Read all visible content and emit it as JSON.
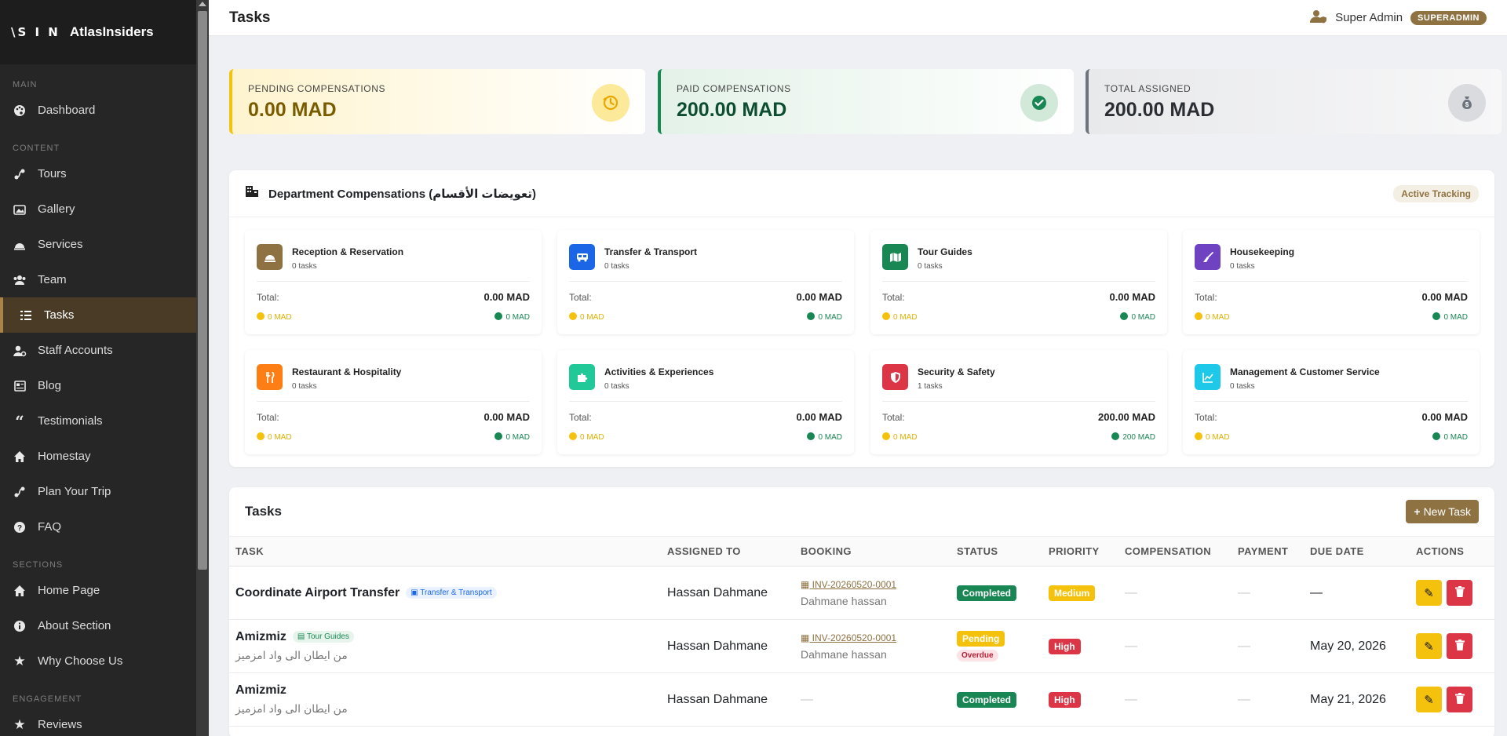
{
  "brand": {
    "logo": "\\S I N",
    "name": "AtlasInsiders"
  },
  "sidebar": {
    "sections": [
      {
        "label": "MAIN",
        "items": [
          {
            "label": "Dashboard",
            "icon": "palette-icon"
          }
        ]
      },
      {
        "label": "CONTENT",
        "items": [
          {
            "label": "Tours",
            "icon": "route-icon"
          },
          {
            "label": "Gallery",
            "icon": "images-icon"
          },
          {
            "label": "Services",
            "icon": "concierge-bell-icon"
          },
          {
            "label": "Team",
            "icon": "users-icon"
          },
          {
            "label": "Tasks",
            "icon": "tasks-icon",
            "active": true
          },
          {
            "label": "Staff Accounts",
            "icon": "user-cog-icon"
          },
          {
            "label": "Blog",
            "icon": "newspaper-icon"
          },
          {
            "label": "Testimonials",
            "icon": "quote-icon"
          },
          {
            "label": "Homestay",
            "icon": "home-icon"
          },
          {
            "label": "Plan Your Trip",
            "icon": "route-icon"
          },
          {
            "label": "FAQ",
            "icon": "question-circle-icon"
          }
        ]
      },
      {
        "label": "SECTIONS",
        "items": [
          {
            "label": "Home Page",
            "icon": "home-icon"
          },
          {
            "label": "About Section",
            "icon": "info-circle-icon"
          },
          {
            "label": "Why Choose Us",
            "icon": "star-icon"
          }
        ]
      },
      {
        "label": "ENGAGEMENT",
        "items": [
          {
            "label": "Reviews",
            "icon": "star-icon"
          }
        ]
      }
    ]
  },
  "header": {
    "title": "Tasks",
    "user_name": "Super Admin",
    "role": "SUPERADMIN"
  },
  "summary": [
    {
      "label": "PENDING COMPENSATIONS",
      "value": "0.00 MAD",
      "icon": "history-icon",
      "color": "#f4c20d"
    },
    {
      "label": "PAID COMPENSATIONS",
      "value": "200.00 MAD",
      "icon": "check-circle-icon",
      "color": "#198754"
    },
    {
      "label": "TOTAL ASSIGNED",
      "value": "200.00 MAD",
      "icon": "money-bag-icon",
      "color": "#6c757d"
    }
  ],
  "departments": {
    "title": "Department Compensations (تعويضات الأقسام)",
    "badge": "Active Tracking",
    "total_label": "Total:",
    "items": [
      {
        "name": "Reception & Reservation",
        "tasks": "0 tasks",
        "total": "0.00 MAD",
        "pending": "0 MAD",
        "paid": "0 MAD",
        "color": "#8e7242",
        "icon": "bell-icon"
      },
      {
        "name": "Transfer & Transport",
        "tasks": "0 tasks",
        "total": "0.00 MAD",
        "pending": "0 MAD",
        "paid": "0 MAD",
        "color": "#1a66e6",
        "icon": "bus-icon"
      },
      {
        "name": "Tour Guides",
        "tasks": "0 tasks",
        "total": "0.00 MAD",
        "pending": "0 MAD",
        "paid": "0 MAD",
        "color": "#198754",
        "icon": "map-icon"
      },
      {
        "name": "Housekeeping",
        "tasks": "0 tasks",
        "total": "0.00 MAD",
        "pending": "0 MAD",
        "paid": "0 MAD",
        "color": "#6f42c1",
        "icon": "broom-icon"
      },
      {
        "name": "Restaurant & Hospitality",
        "tasks": "0 tasks",
        "total": "0.00 MAD",
        "pending": "0 MAD",
        "paid": "0 MAD",
        "color": "#fd7e14",
        "icon": "utensils-icon"
      },
      {
        "name": "Activities & Experiences",
        "tasks": "0 tasks",
        "total": "0.00 MAD",
        "pending": "0 MAD",
        "paid": "0 MAD",
        "color": "#20c997",
        "icon": "puzzle-icon"
      },
      {
        "name": "Security & Safety",
        "tasks": "1 tasks",
        "total": "200.00 MAD",
        "pending": "0 MAD",
        "paid": "200 MAD",
        "color": "#dc3545",
        "icon": "shield-icon"
      },
      {
        "name": "Management & Customer Service",
        "tasks": "0 tasks",
        "total": "0.00 MAD",
        "pending": "0 MAD",
        "paid": "0 MAD",
        "color": "#1ec8e8",
        "icon": "chart-icon"
      }
    ]
  },
  "tasks": {
    "title": "Tasks",
    "new_label": "New Task",
    "columns": [
      "TASK",
      "ASSIGNED TO",
      "BOOKING",
      "STATUS",
      "PRIORITY",
      "COMPENSATION",
      "PAYMENT",
      "DUE DATE",
      "ACTIONS"
    ],
    "rows": [
      {
        "title": "Coordinate Airport Transfer",
        "tag": "Transfer & Transport",
        "subtitle": "",
        "assigned": "Hassan Dahmane",
        "invoice": "INV-20260520-0001",
        "customer": "Dahmane hassan",
        "status": "Completed",
        "overdue": "",
        "priority": "Medium",
        "compensation": "—",
        "payment": "—",
        "due": "—"
      },
      {
        "title": "Amizmiz",
        "tag": "Tour Guides",
        "subtitle": "من ايطان الى واد امزميز",
        "assigned": "Hassan Dahmane",
        "invoice": "INV-20260520-0001",
        "customer": "Dahmane hassan",
        "status": "Pending",
        "overdue": "Overdue",
        "priority": "High",
        "compensation": "—",
        "payment": "—",
        "due": "May 20, 2026"
      },
      {
        "title": "Amizmiz",
        "tag": "",
        "subtitle": "من ايطان الى واد امزميز",
        "assigned": "Hassan Dahmane",
        "invoice": "",
        "customer": "",
        "status": "Completed",
        "overdue": "",
        "priority": "High",
        "compensation": "—",
        "payment": "—",
        "due": "May 21, 2026"
      }
    ]
  }
}
